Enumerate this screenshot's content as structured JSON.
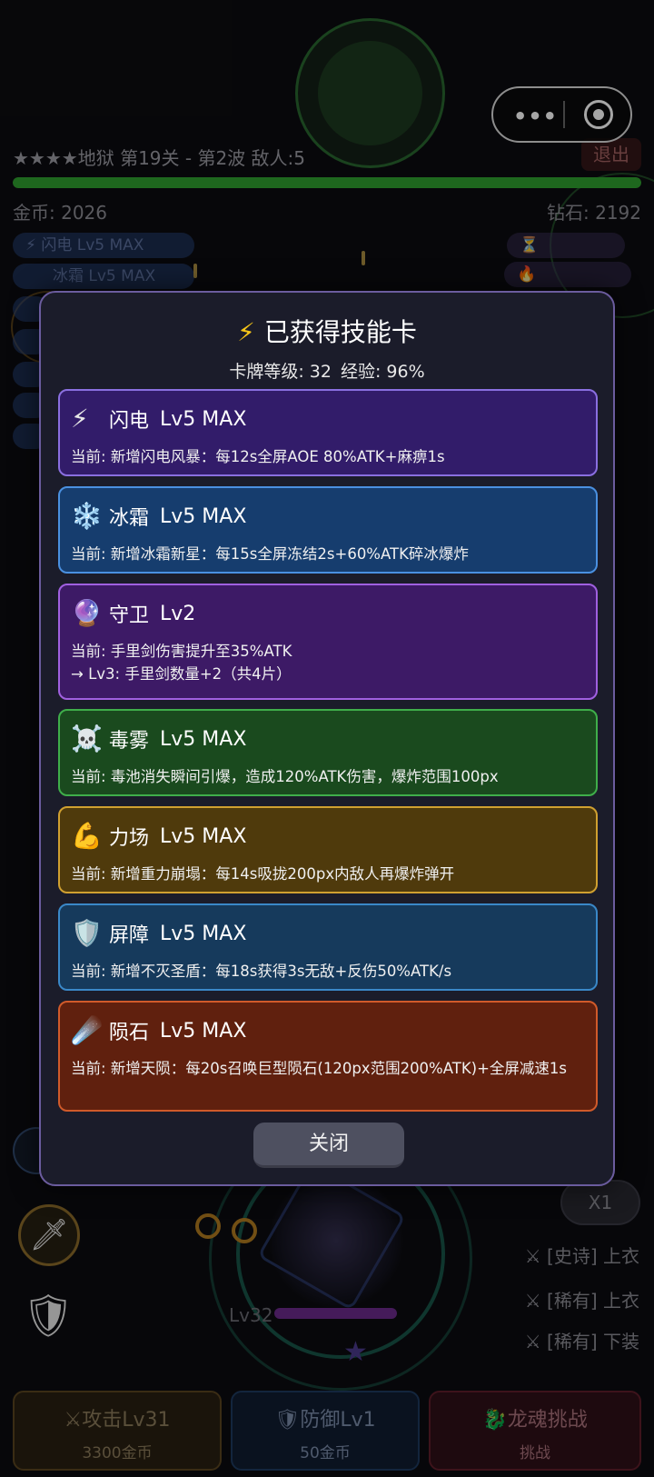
{
  "hud": {
    "stage_info": "★★★★地狱  第19关 - 第2波  敌人:5",
    "exit_label": "退出",
    "wave_progress": 1.0,
    "gold": "金币: 2026",
    "gems": "钻石: 2192",
    "buff_1": "⚡ 闪电 Lv5 MAX",
    "buff_2": "冰霜 Lv5 MAX",
    "status_1": "⏳",
    "status_2": "🔥"
  },
  "mini_program": {
    "more_label": "•••",
    "close_label": "◉"
  },
  "side": {
    "speed_label": "X1",
    "loot": [
      {
        "icon": "⚔",
        "text": "[史诗] 上衣"
      },
      {
        "icon": "⚔",
        "text": "[稀有] 上衣"
      },
      {
        "icon": "⚔",
        "text": "[稀有] 下装"
      }
    ],
    "player_level": "Lv32"
  },
  "bottom": {
    "attack": {
      "title": "⚔攻击Lv31",
      "cost": "3300金币"
    },
    "defense": {
      "title": "🛡防御Lv1",
      "cost": "50金币"
    },
    "dragon": {
      "title": "🐉龙魂挑战",
      "cost": "挑战"
    }
  },
  "modal": {
    "title_icon": "⚡",
    "title": "已获得技能卡",
    "card_level": "卡牌等级: 32",
    "exp": "经验: 96%",
    "close_label": "关闭",
    "cards": [
      {
        "icon": "⚡",
        "name": "闪电",
        "level": "Lv5 MAX",
        "desc": "当前: 新增闪电风暴：每12s全屏AOE 80%ATK+麻痹1s",
        "next": ""
      },
      {
        "icon": "❄️",
        "name": "冰霜",
        "level": "Lv5 MAX",
        "desc": "当前: 新增冰霜新星：每15s全屏冻结2s+60%ATK碎冰爆炸",
        "next": ""
      },
      {
        "icon": "🔮",
        "name": "守卫",
        "level": "Lv2",
        "desc": "当前: 手里剑伤害提升至35%ATK",
        "next": "→ Lv3: 手里剑数量+2（共4片）"
      },
      {
        "icon": "☠️",
        "name": "毒雾",
        "level": "Lv5 MAX",
        "desc": "当前: 毒池消失瞬间引爆，造成120%ATK伤害，爆炸范围100px",
        "next": ""
      },
      {
        "icon": "💪",
        "name": "力场",
        "level": "Lv5 MAX",
        "desc": "当前: 新增重力崩塌：每14s吸拢200px内敌人再爆炸弹开",
        "next": ""
      },
      {
        "icon": "🛡️",
        "name": "屏障",
        "level": "Lv5 MAX",
        "desc": "当前: 新增不灭圣盾：每18s获得3s无敌+反伤50%ATK/s",
        "next": ""
      },
      {
        "icon": "☄️",
        "name": "陨石",
        "level": "Lv5 MAX",
        "desc": "当前: 新增天陨：每20s召唤巨型陨石(120px范围200%ATK)+全屏减速1s",
        "next": ""
      }
    ]
  },
  "colors": {
    "lightning_bg": "#321c6a",
    "lightning_border": "#8a6fe0",
    "frost_bg": "#163d6e",
    "frost_border": "#4a90e0",
    "guard_bg": "#3d1a66",
    "guard_border": "#a060e0",
    "poison_bg": "#1a4a1e",
    "poison_border": "#3fae4a",
    "force_bg": "#4f3a0c",
    "force_border": "#d0a030",
    "shield_bg": "#163a5c",
    "shield_border": "#3a88c8",
    "meteor_bg": "#60200e",
    "meteor_border": "#d05a2a"
  }
}
